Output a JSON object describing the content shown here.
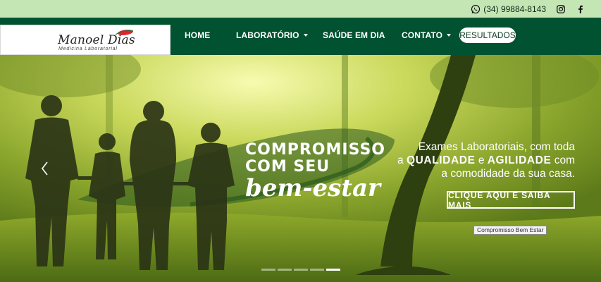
{
  "topbar": {
    "phone": "(34) 99884-8143",
    "icons": [
      "whatsapp-icon",
      "instagram-icon",
      "facebook-icon"
    ]
  },
  "logo": {
    "name": "Manoel Dias",
    "subtitle": "Medicina Laboratorial"
  },
  "nav": {
    "home": "HOME",
    "laboratorio": "LABORATÓRIO",
    "saude": "SAÚDE EM DIA",
    "contato": "CONTATO",
    "resultados": "RESULTADOS"
  },
  "hero": {
    "headline_line1": "COMPROMISSO",
    "headline_line2": "COM SEU",
    "headline_line3": "bem-estar",
    "tagline_line1": "Exames Laboratoriais, com toda",
    "tagline_a": "a ",
    "tagline_qualidade": "QUALIDADE",
    "tagline_e": " e ",
    "tagline_agilidade": "AGILIDADE",
    "tagline_com": " com",
    "tagline_line3": "a comodidade da sua casa.",
    "cta": "CLIQUE AQUI E SAIBA MAIS",
    "tooltip": "Compromisso Bem Estar",
    "slide_count": 5,
    "active_slide": 5
  },
  "colors": {
    "topbar": "#c4e6b5",
    "navbar": "#005231",
    "accent_red": "#d9262b",
    "white": "#ffffff"
  }
}
